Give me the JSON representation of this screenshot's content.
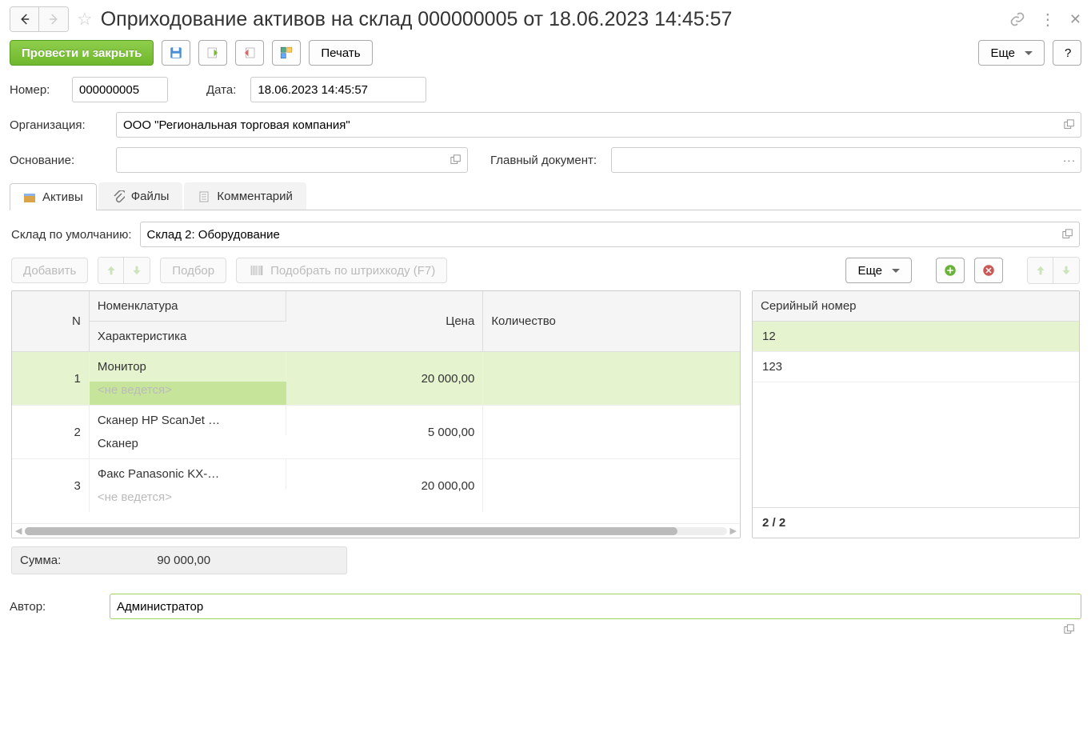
{
  "title": "Оприходование активов на склад 000000005 от 18.06.2023 14:45:57",
  "toolbar": {
    "post_and_close": "Провести и закрыть",
    "print": "Печать",
    "more": "Еще",
    "help": "?"
  },
  "fields": {
    "number_label": "Номер:",
    "number_value": "000000005",
    "date_label": "Дата:",
    "date_value": "18.06.2023 14:45:57",
    "org_label": "Организация:",
    "org_value": "ООО \"Региональная торговая компания\"",
    "basis_label": "Основание:",
    "basis_value": "",
    "maindoc_label": "Главный документ:",
    "maindoc_value": ""
  },
  "tabs": {
    "assets": "Активы",
    "files": "Файлы",
    "comment": "Комментарий"
  },
  "assets_panel": {
    "default_wh_label": "Склад по умолчанию:",
    "default_wh_value": "Склад 2: Оборудование",
    "add": "Добавить",
    "selection": "Подбор",
    "barcode": "Подобрать по штрихкоду (F7)",
    "more": "Еще"
  },
  "table": {
    "hdr_n": "N",
    "hdr_nom": "Номенклатура",
    "hdr_char": "Характеристика",
    "hdr_price": "Цена",
    "hdr_qty": "Количество",
    "rows": [
      {
        "n": "1",
        "nom": "Монитор",
        "char": "<не ведется>",
        "price": "20 000,00",
        "qty": ""
      },
      {
        "n": "2",
        "nom": "Сканер HP ScanJet …",
        "char": "Сканер",
        "price": "5 000,00",
        "qty": ""
      },
      {
        "n": "3",
        "nom": "Факс Panasonic KX-…",
        "char": "<не ведется>",
        "price": "20 000,00",
        "qty": ""
      }
    ]
  },
  "serials": {
    "header": "Серийный номер",
    "rows": [
      "12",
      "123"
    ],
    "footer": "2 / 2"
  },
  "sum": {
    "label": "Сумма:",
    "value": "90 000,00"
  },
  "author": {
    "label": "Автор:",
    "value": "Администратор"
  }
}
